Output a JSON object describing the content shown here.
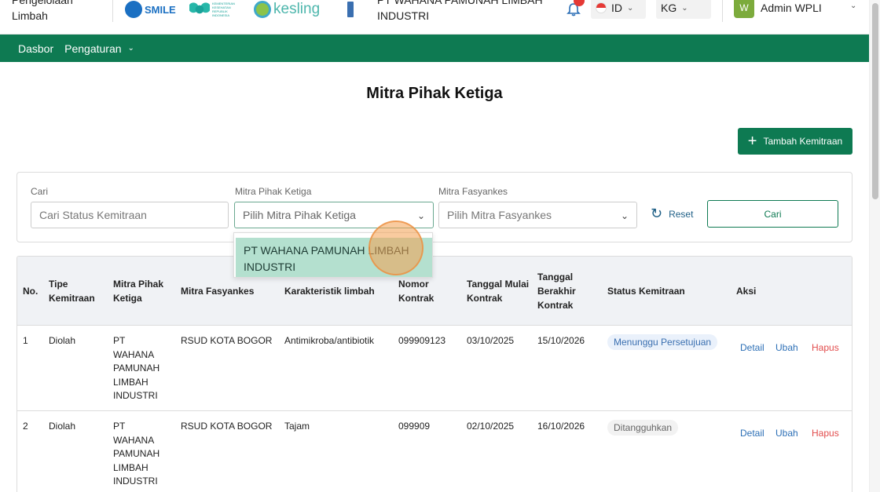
{
  "header": {
    "app_name": "Pengelolaan Limbah",
    "logos": [
      "SMILE",
      "KEMENTERIAN KESEHATAN REPUBLIK INDONESIA",
      "kesling"
    ],
    "company_name": "PT WAHANA PAMUNAH LIMBAH INDUSTRI",
    "language": "ID",
    "unit": "KG",
    "user_initial": "W",
    "user_name": "Admin WPLI"
  },
  "nav": {
    "items": [
      {
        "label": "Dasbor"
      },
      {
        "label": "Pengaturan"
      }
    ]
  },
  "page": {
    "title": "Mitra Pihak Ketiga",
    "add_button": "Tambah Kemitraan"
  },
  "filters": {
    "search_label": "Cari",
    "search_placeholder": "Cari Status Kemitraan",
    "partner_label": "Mitra Pihak Ketiga",
    "partner_placeholder": "Pilih Mitra Pihak Ketiga",
    "facility_label": "Mitra Fasyankes",
    "facility_placeholder": "Pilih Mitra Fasyankes",
    "reset_label": "Reset",
    "submit_label": "Cari"
  },
  "dropdown": {
    "options": [
      "PT WAHANA PAMUNAH LIMBAH INDUSTRI"
    ]
  },
  "table": {
    "headers": {
      "no": "No.",
      "type": "Tipe Kemitraan",
      "partner": "Mitra Pihak Ketiga",
      "facility": "Mitra Fasyankes",
      "waste": "Karakteristik limbah",
      "contract_no": "Nomor Kontrak",
      "start": "Tanggal Mulai Kontrak",
      "end": "Tanggal Berakhir Kontrak",
      "status": "Status Kemitraan",
      "actions": "Aksi"
    },
    "rows": [
      {
        "no": "1",
        "type": "Diolah",
        "partner": "PT WAHANA PAMUNAH LIMBAH INDUSTRI",
        "facility": "RSUD KOTA BOGOR",
        "waste": "Antimikroba/antibiotik",
        "contract_no": "099909123",
        "start": "03/10/2025",
        "end": "15/10/2026",
        "status": "Menunggu Persetujuan"
      },
      {
        "no": "2",
        "type": "Diolah",
        "partner": "PT WAHANA PAMUNAH LIMBAH INDUSTRI",
        "facility": "RSUD KOTA BOGOR",
        "waste": "Tajam",
        "contract_no": "099909",
        "start": "02/10/2025",
        "end": "16/10/2026",
        "status": "Ditangguhkan"
      }
    ],
    "actions": {
      "detail": "Detail",
      "edit": "Ubah",
      "delete": "Hapus"
    }
  },
  "colors": {
    "primary": "#0e7a52",
    "dropdown_highlight": "#b4e0cf",
    "link": "#2c6fb6",
    "danger": "#e24c4c"
  }
}
